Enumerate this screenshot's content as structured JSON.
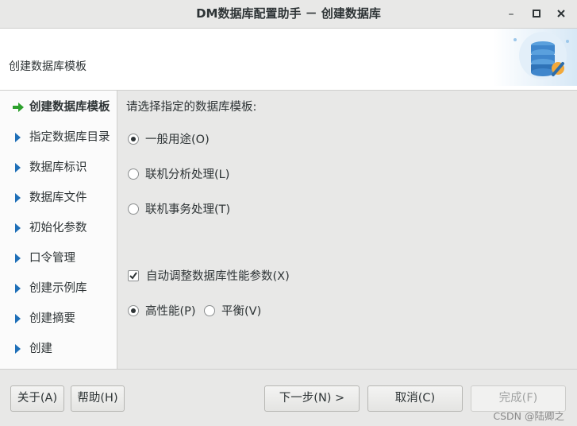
{
  "window": {
    "title": "DM数据库配置助手 － 创建数据库",
    "minimize_glyph": "–",
    "maximize_glyph": "□",
    "close_glyph": "×"
  },
  "header": {
    "title": "创建数据库模板",
    "logo_icon": "database-gear-icon"
  },
  "sidebar": {
    "items": [
      {
        "label": "创建数据库模板",
        "active": true
      },
      {
        "label": "指定数据库目录",
        "active": false
      },
      {
        "label": "数据库标识",
        "active": false
      },
      {
        "label": "数据库文件",
        "active": false
      },
      {
        "label": "初始化参数",
        "active": false
      },
      {
        "label": "口令管理",
        "active": false
      },
      {
        "label": "创建示例库",
        "active": false
      },
      {
        "label": "创建摘要",
        "active": false
      },
      {
        "label": "创建",
        "active": false
      }
    ]
  },
  "main": {
    "prompt": "请选择指定的数据库模板:",
    "templates": [
      {
        "label": "一般用途(O)",
        "selected": true
      },
      {
        "label": "联机分析处理(L)",
        "selected": false
      },
      {
        "label": "联机事务处理(T)",
        "selected": false
      }
    ],
    "auto_tune": {
      "label": "自动调整数据库性能参数(X)",
      "checked": true
    },
    "performance": [
      {
        "label": "高性能(P)",
        "selected": true
      },
      {
        "label": "平衡(V)",
        "selected": false
      }
    ]
  },
  "footer": {
    "about": "关于(A)",
    "help": "帮助(H)",
    "next": "下一步(N) >",
    "cancel": "取消(C)",
    "finish": "完成(F)",
    "watermark": "CSDN @陆卿之"
  },
  "colors": {
    "accent_blue": "#1e6fb8",
    "current_arrow_green": "#2ca02c"
  }
}
